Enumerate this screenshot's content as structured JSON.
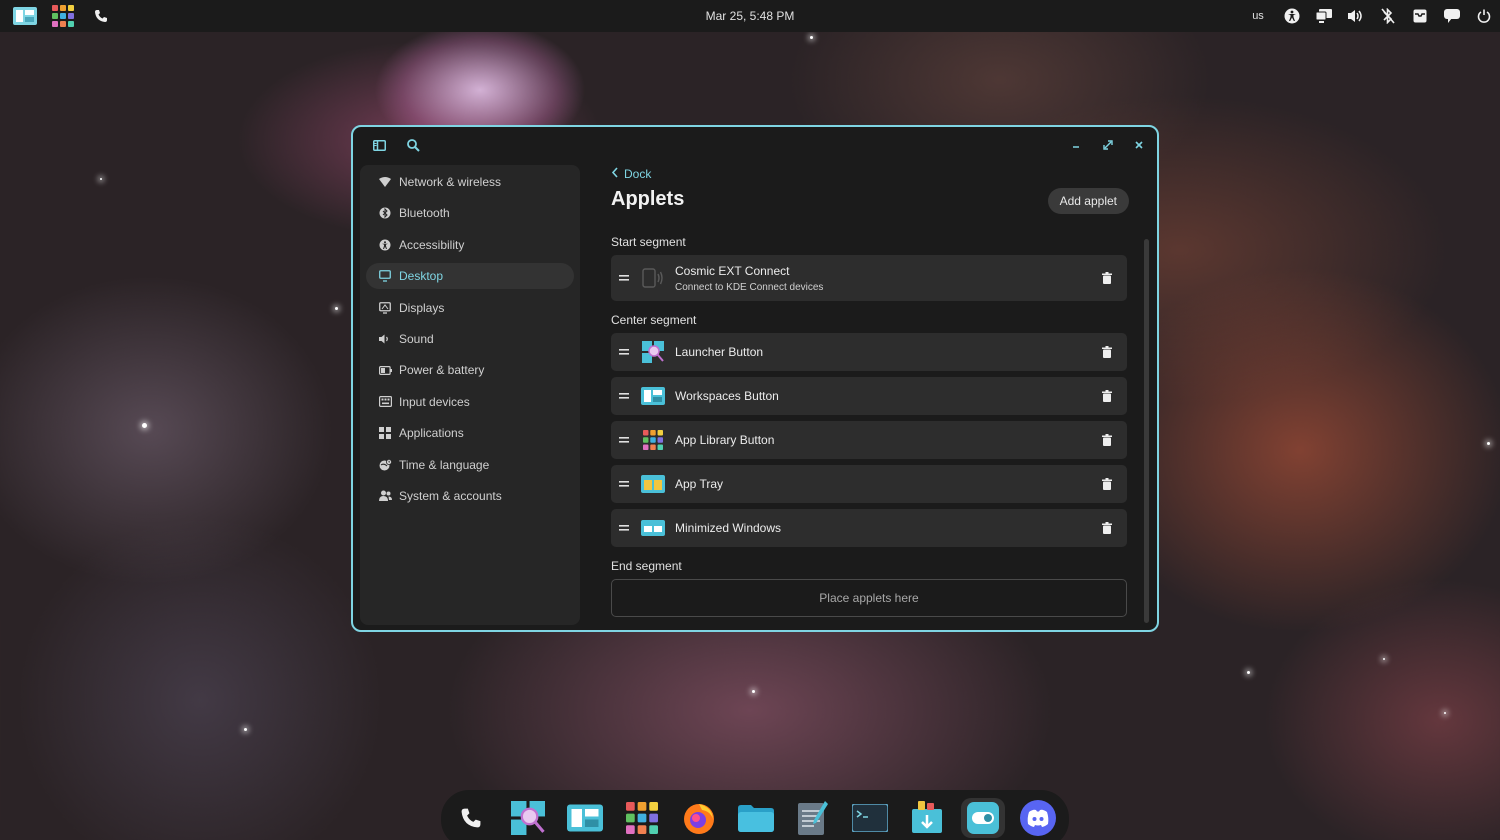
{
  "top_panel": {
    "clock": "Mar 25, 5:48 PM",
    "keyboard_layout": "us",
    "left_icons": [
      "workspaces-icon",
      "app-library-icon",
      "phone-icon"
    ],
    "right_icons": [
      "accessibility-icon",
      "display-icon",
      "volume-icon",
      "bluetooth-off-icon",
      "notifications-icon",
      "chat-icon",
      "power-icon"
    ]
  },
  "sidebar": {
    "items": [
      {
        "label": "Network & wireless",
        "icon": "wifi-icon"
      },
      {
        "label": "Bluetooth",
        "icon": "bluetooth-icon"
      },
      {
        "label": "Accessibility",
        "icon": "accessibility-icon"
      },
      {
        "label": "Desktop",
        "icon": "desktop-icon",
        "active": true
      },
      {
        "label": "Displays",
        "icon": "displays-icon"
      },
      {
        "label": "Sound",
        "icon": "sound-icon"
      },
      {
        "label": "Power & battery",
        "icon": "battery-icon"
      },
      {
        "label": "Input devices",
        "icon": "keyboard-icon"
      },
      {
        "label": "Applications",
        "icon": "applications-icon"
      },
      {
        "label": "Time & language",
        "icon": "globe-clock-icon"
      },
      {
        "label": "System & accounts",
        "icon": "users-icon"
      }
    ]
  },
  "content": {
    "back_label": "Dock",
    "title": "Applets",
    "add_button": "Add applet",
    "start_segment": {
      "label": "Start segment",
      "applets": [
        {
          "name": "Cosmic EXT Connect",
          "subtitle": "Connect to KDE Connect devices",
          "icon": "kde-connect-icon"
        }
      ]
    },
    "center_segment": {
      "label": "Center segment",
      "applets": [
        {
          "name": "Launcher Button",
          "icon": "launcher-icon"
        },
        {
          "name": "Workspaces Button",
          "icon": "workspaces-icon"
        },
        {
          "name": "App Library Button",
          "icon": "app-library-icon"
        },
        {
          "name": "App Tray",
          "icon": "app-tray-icon"
        },
        {
          "name": "Minimized Windows",
          "icon": "minimized-windows-icon"
        }
      ]
    },
    "end_segment": {
      "label": "End segment",
      "placeholder": "Place applets here"
    }
  },
  "dock": {
    "items": [
      "phone-icon",
      "launcher-icon",
      "workspaces-icon",
      "app-library-icon",
      "firefox-icon",
      "files-icon",
      "text-editor-icon",
      "terminal-icon",
      "store-icon",
      "settings-icon",
      "discord-icon"
    ],
    "active": "settings-icon"
  },
  "colors": {
    "accent": "#7fd5e3",
    "panel": "#1b1b1b",
    "row": "#2d2d2d"
  }
}
